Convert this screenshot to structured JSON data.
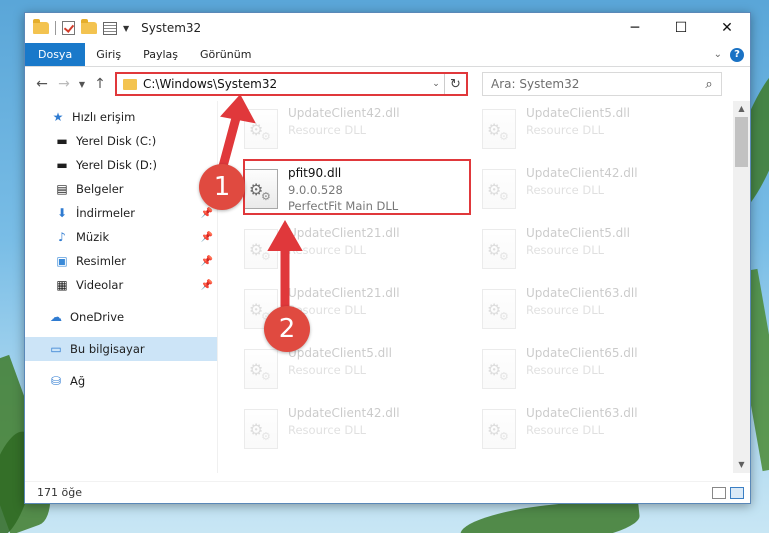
{
  "window": {
    "title": "System32",
    "controls": {
      "minimize": "─",
      "maximize": "☐",
      "close": "✕"
    }
  },
  "ribbon": {
    "tabs": [
      "Dosya",
      "Giriş",
      "Paylaş",
      "Görünüm"
    ]
  },
  "navbar": {
    "address": "C:\\Windows\\System32",
    "search_placeholder": "Ara: System32"
  },
  "sidebar": {
    "quick_access": "Hızlı erişim",
    "items": [
      {
        "label": "Yerel Disk (C:)",
        "icon": "drive-icon",
        "pinned": false
      },
      {
        "label": "Yerel Disk (D:)",
        "icon": "drive-icon",
        "pinned": false
      },
      {
        "label": "Belgeler",
        "icon": "document-icon",
        "pinned": false
      },
      {
        "label": "İndirmeler",
        "icon": "download-icon",
        "pinned": true
      },
      {
        "label": "Müzik",
        "icon": "music-icon",
        "pinned": true
      },
      {
        "label": "Resimler",
        "icon": "pictures-icon",
        "pinned": true
      },
      {
        "label": "Videolar",
        "icon": "video-icon",
        "pinned": true
      }
    ],
    "onedrive": "OneDrive",
    "this_pc": "Bu bilgisayar",
    "network": "Ağ"
  },
  "files": [
    {
      "name": "UpdateClient42.dll",
      "desc": "Resource DLL",
      "ghost": true
    },
    {
      "name": "UpdateClient5.dll",
      "desc": "Resource DLL",
      "ghost": true
    },
    {
      "name": "pfit90.dll",
      "version": "9.0.0.528",
      "desc": "PerfectFit Main DLL",
      "ghost": false
    },
    {
      "name": "UpdateClient42.dll",
      "desc": "Resource DLL",
      "ghost": true
    },
    {
      "name": "UpdateClient21.dll",
      "desc": "Resource DLL",
      "ghost": true
    },
    {
      "name": "UpdateClient5.dll",
      "desc": "Resource DLL",
      "ghost": true
    },
    {
      "name": "UpdateClient21.dll",
      "desc": "Resource DLL",
      "ghost": true
    },
    {
      "name": "UpdateClient63.dll",
      "desc": "Resource DLL",
      "ghost": true
    },
    {
      "name": "UpdateClient5.dll",
      "desc": "Resource DLL",
      "ghost": true
    },
    {
      "name": "UpdateClient65.dll",
      "desc": "Resource DLL",
      "ghost": true
    },
    {
      "name": "UpdateClient42.dll",
      "desc": "Resource DLL",
      "ghost": true
    },
    {
      "name": "UpdateClient63.dll",
      "desc": "Resource DLL",
      "ghost": true
    }
  ],
  "status": {
    "count": "171 öğe"
  },
  "annotations": {
    "step1": "1",
    "step2": "2",
    "color": "#e0383b"
  }
}
